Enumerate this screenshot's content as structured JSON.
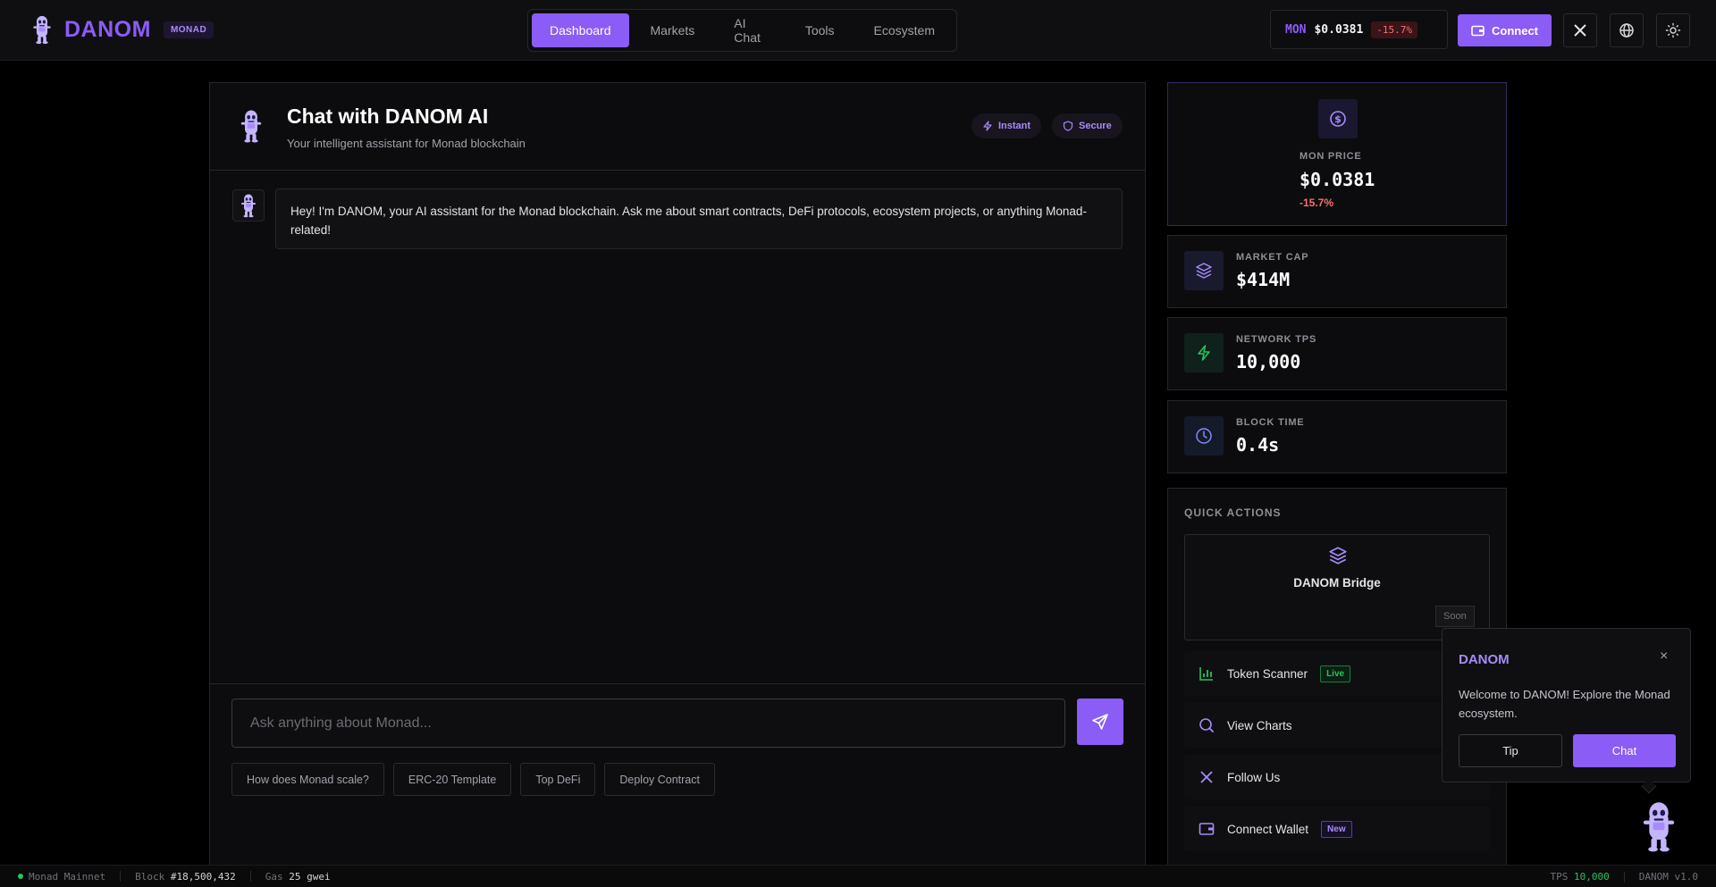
{
  "header": {
    "brand": "DANOM",
    "network_tag": "MONAD",
    "nav": [
      {
        "label": "Dashboard",
        "active": true
      },
      {
        "label": "Markets",
        "active": false
      },
      {
        "label": "AI Chat",
        "active": false
      },
      {
        "label": "Tools",
        "active": false
      },
      {
        "label": "Ecosystem",
        "active": false
      }
    ],
    "ticker": {
      "symbol": "MON",
      "price": "$0.0381",
      "change": "-15.7%"
    },
    "connect_label": "Connect",
    "icons": [
      "x-icon",
      "globe-icon",
      "sun-icon"
    ]
  },
  "chat": {
    "title": "Chat with DANOM AI",
    "subtitle": "Your intelligent assistant for Monad blockchain",
    "pills": [
      "Instant",
      "Secure"
    ],
    "messages": [
      {
        "role": "assistant",
        "text": "Hey! I'm DANOM, your AI assistant for the Monad blockchain. Ask me about smart contracts, DeFi protocols, ecosystem projects, or anything Monad-related!"
      }
    ],
    "input_placeholder": "Ask anything about Monad...",
    "suggestions": [
      "How does Monad scale?",
      "ERC-20 Template",
      "Top DeFi",
      "Deploy Contract"
    ]
  },
  "stats": {
    "price": {
      "label": "MON PRICE",
      "value": "$0.0381",
      "change": "-15.7%"
    },
    "market_cap": {
      "label": "MARKET CAP",
      "value": "$414M"
    },
    "tps": {
      "label": "NETWORK TPS",
      "value": "10,000"
    },
    "block_time": {
      "label": "BLOCK TIME",
      "value": "0.4s"
    }
  },
  "quick_actions": {
    "title": "QUICK ACTIONS",
    "bridge": {
      "label": "DANOM Bridge",
      "badge": "Soon"
    },
    "items": [
      {
        "label": "Token Scanner",
        "badge": "Live"
      },
      {
        "label": "View Charts",
        "badge": ""
      },
      {
        "label": "Follow Us",
        "badge": ""
      },
      {
        "label": "Connect Wallet",
        "badge": "New"
      }
    ]
  },
  "popup": {
    "title": "DANOM",
    "close": "×",
    "text": "Welcome to DANOM! Explore the Monad ecosystem.",
    "tip_label": "Tip",
    "chat_label": "Chat"
  },
  "statusbar": {
    "network": "Monad Mainnet",
    "block_label": "Block",
    "block_value": "#18,500,432",
    "gas_label": "Gas",
    "gas_value": "25 gwei",
    "tps_label": "TPS",
    "tps_value": "10,000",
    "version": "DANOM v1.0"
  },
  "colors": {
    "accent": "#8b5cf6",
    "negative": "#f87171",
    "positive": "#22c55e"
  }
}
